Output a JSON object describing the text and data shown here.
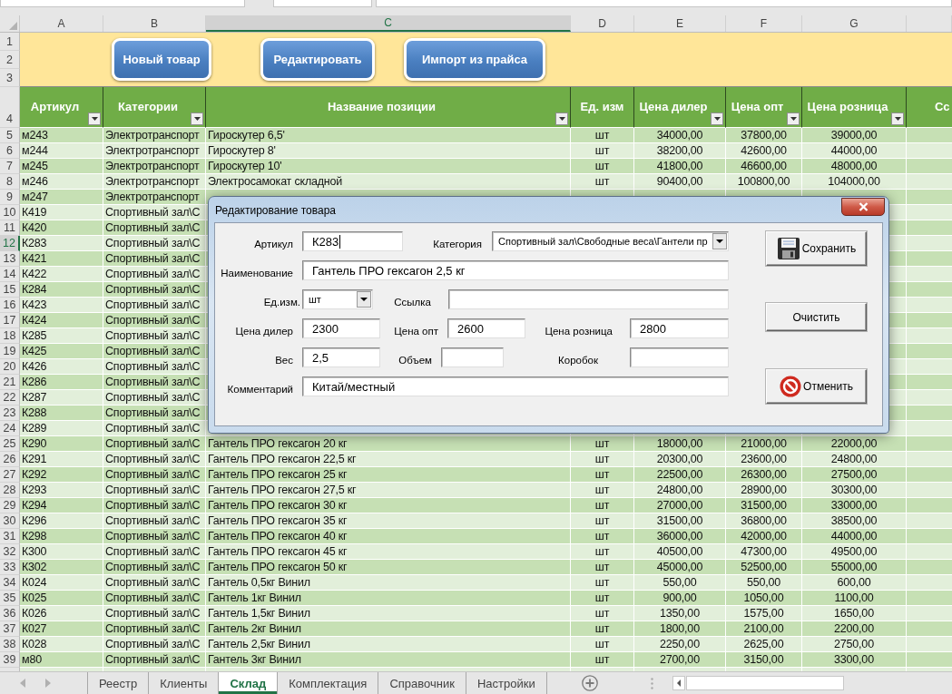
{
  "column_letters": [
    {
      "label": "A",
      "selected": false
    },
    {
      "label": "B",
      "selected": false
    },
    {
      "label": "C",
      "selected": true
    },
    {
      "label": "D",
      "selected": false
    },
    {
      "label": "E",
      "selected": false
    },
    {
      "label": "F",
      "selected": false
    },
    {
      "label": "G",
      "selected": false
    }
  ],
  "band_row_numbers": [
    "1",
    "2",
    "3"
  ],
  "toolbar_buttons": [
    "Новый товар",
    "Редактировать",
    "Импорт из прайса"
  ],
  "header": {
    "row_number": "4",
    "columns": [
      {
        "label": "Артикул",
        "filter": true
      },
      {
        "label": "Категории",
        "filter": true
      },
      {
        "label": "Название позиции",
        "filter": true
      },
      {
        "label": "Ед. изм",
        "filter": false
      },
      {
        "label": "Цена дилер",
        "filter": true
      },
      {
        "label": "Цена опт",
        "filter": true
      },
      {
        "label": "Цена розница",
        "filter": true
      },
      {
        "label": "Сс",
        "filter": false
      }
    ]
  },
  "rows": [
    {
      "number": "5",
      "selected": false,
      "cells": [
        "м243",
        "Электротранспорт",
        "Гироскутер 6,5'",
        "шт",
        "34000,00",
        "37800,00",
        "39000,00"
      ]
    },
    {
      "number": "6",
      "selected": false,
      "cells": [
        "м244",
        "Электротранспорт",
        "Гироскутер 8'",
        "шт",
        "38200,00",
        "42600,00",
        "44000,00"
      ]
    },
    {
      "number": "7",
      "selected": false,
      "cells": [
        "м245",
        "Электротранспорт",
        "Гироскутер 10'",
        "шт",
        "41800,00",
        "46600,00",
        "48000,00"
      ]
    },
    {
      "number": "8",
      "selected": false,
      "cells": [
        "м246",
        "Электротранспорт",
        "Электросамокат складной",
        "шт",
        "90400,00",
        "100800,00",
        "104000,00"
      ]
    },
    {
      "number": "9",
      "selected": false,
      "cells": [
        "м247",
        "Электротранспорт"
      ]
    },
    {
      "number": "10",
      "selected": false,
      "cells": [
        "К419",
        "Спортивный зал\\С"
      ]
    },
    {
      "number": "11",
      "selected": false,
      "cells": [
        "К420",
        "Спортивный зал\\С"
      ]
    },
    {
      "number": "12",
      "selected": true,
      "cells": [
        "К283",
        "Спортивный зал\\С"
      ]
    },
    {
      "number": "13",
      "selected": false,
      "cells": [
        "К421",
        "Спортивный зал\\С"
      ]
    },
    {
      "number": "14",
      "selected": false,
      "cells": [
        "К422",
        "Спортивный зал\\С"
      ]
    },
    {
      "number": "15",
      "selected": false,
      "cells": [
        "К284",
        "Спортивный зал\\С"
      ]
    },
    {
      "number": "16",
      "selected": false,
      "cells": [
        "К423",
        "Спортивный зал\\С"
      ]
    },
    {
      "number": "17",
      "selected": false,
      "cells": [
        "К424",
        "Спортивный зал\\С"
      ]
    },
    {
      "number": "18",
      "selected": false,
      "cells": [
        "К285",
        "Спортивный зал\\С"
      ]
    },
    {
      "number": "19",
      "selected": false,
      "cells": [
        "К425",
        "Спортивный зал\\С"
      ]
    },
    {
      "number": "20",
      "selected": false,
      "cells": [
        "К426",
        "Спортивный зал\\С"
      ]
    },
    {
      "number": "21",
      "selected": false,
      "cells": [
        "К286",
        "Спортивный зал\\С"
      ]
    },
    {
      "number": "22",
      "selected": false,
      "cells": [
        "К287",
        "Спортивный зал\\С"
      ]
    },
    {
      "number": "23",
      "selected": false,
      "cells": [
        "К288",
        "Спортивный зал\\С"
      ]
    },
    {
      "number": "24",
      "selected": false,
      "cells": [
        "К289",
        "Спортивный зал\\С"
      ]
    },
    {
      "number": "25",
      "selected": false,
      "cells": [
        "К290",
        "Спортивный зал\\С",
        "Гантель ПРО гексагон 20 кг",
        "шт",
        "18000,00",
        "21000,00",
        "22000,00"
      ]
    },
    {
      "number": "26",
      "selected": false,
      "cells": [
        "К291",
        "Спортивный зал\\С",
        "Гантель ПРО гексагон 22,5 кг",
        "шт",
        "20300,00",
        "23600,00",
        "24800,00"
      ]
    },
    {
      "number": "27",
      "selected": false,
      "cells": [
        "К292",
        "Спортивный зал\\С",
        "Гантель ПРО гексагон 25 кг",
        "шт",
        "22500,00",
        "26300,00",
        "27500,00"
      ]
    },
    {
      "number": "28",
      "selected": false,
      "cells": [
        "К293",
        "Спортивный зал\\С",
        "Гантель ПРО гексагон 27,5 кг",
        "шт",
        "24800,00",
        "28900,00",
        "30300,00"
      ]
    },
    {
      "number": "29",
      "selected": false,
      "cells": [
        "К294",
        "Спортивный зал\\С",
        "Гантель ПРО гексагон 30 кг",
        "шт",
        "27000,00",
        "31500,00",
        "33000,00"
      ]
    },
    {
      "number": "30",
      "selected": false,
      "cells": [
        "К296",
        "Спортивный зал\\С",
        "Гантель ПРО гексагон 35 кг",
        "шт",
        "31500,00",
        "36800,00",
        "38500,00"
      ]
    },
    {
      "number": "31",
      "selected": false,
      "cells": [
        "К298",
        "Спортивный зал\\С",
        "Гантель ПРО гексагон 40 кг",
        "шт",
        "36000,00",
        "42000,00",
        "44000,00"
      ]
    },
    {
      "number": "32",
      "selected": false,
      "cells": [
        "К300",
        "Спортивный зал\\С",
        "Гантель ПРО гексагон 45 кг",
        "шт",
        "40500,00",
        "47300,00",
        "49500,00"
      ]
    },
    {
      "number": "33",
      "selected": false,
      "cells": [
        "К302",
        "Спортивный зал\\С",
        "Гантель ПРО гексагон 50 кг",
        "шт",
        "45000,00",
        "52500,00",
        "55000,00"
      ]
    },
    {
      "number": "34",
      "selected": false,
      "cells": [
        "К024",
        "Спортивный зал\\С",
        "Гантель 0,5кг Винил",
        "шт",
        "550,00",
        "550,00",
        "600,00"
      ]
    },
    {
      "number": "35",
      "selected": false,
      "cells": [
        "К025",
        "Спортивный зал\\С",
        "Гантель 1кг Винил",
        "шт",
        "900,00",
        "1050,00",
        "1100,00"
      ]
    },
    {
      "number": "36",
      "selected": false,
      "cells": [
        "К026",
        "Спортивный зал\\С",
        "Гантель 1,5кг Винил",
        "шт",
        "1350,00",
        "1575,00",
        "1650,00"
      ]
    },
    {
      "number": "37",
      "selected": false,
      "cells": [
        "К027",
        "Спортивный зал\\С",
        "Гантель 2кг Винил",
        "шт",
        "1800,00",
        "2100,00",
        "2200,00"
      ]
    },
    {
      "number": "38",
      "selected": false,
      "cells": [
        "К028",
        "Спортивный зал\\С",
        "Гантель 2,5кг Винил",
        "шт",
        "2250,00",
        "2625,00",
        "2750,00"
      ]
    },
    {
      "number": "39",
      "selected": false,
      "cells": [
        "м80",
        "Спортивный зал\\С",
        "Гантель 3кг Винил",
        "шт",
        "2700,00",
        "3150,00",
        "3300,00"
      ]
    }
  ],
  "dialog": {
    "title": "Редактирование товара",
    "rows": [
      [
        {
          "label": "Артикул",
          "kind": "text",
          "value": "К283",
          "focused": true
        },
        {
          "label": "Категория",
          "kind": "combo",
          "value": "Спортивный зал\\Свободные веса\\Гантели пр",
          "focused": false
        }
      ],
      [
        {
          "label": "Наименование",
          "kind": "text",
          "value": "Гантель ПРО гексагон 2,5 кг",
          "focused": false
        }
      ],
      [
        {
          "label": "Ед.изм.",
          "kind": "combo",
          "value": "шт",
          "focused": false
        },
        {
          "label": "Ссылка",
          "kind": "text",
          "focused": false
        }
      ],
      [
        {
          "label": "Цена дилер",
          "kind": "text",
          "value": "2300",
          "focused": false
        },
        {
          "label": "Цена опт",
          "kind": "text",
          "value": "2600",
          "focused": false
        },
        {
          "label": "Цена розница",
          "kind": "text",
          "value": "2800",
          "focused": false
        }
      ],
      [
        {
          "label": "Вес",
          "kind": "text",
          "value": "2,5",
          "focused": false
        },
        {
          "label": "Объем",
          "kind": "text",
          "focused": false
        },
        {
          "label": "Коробок",
          "kind": "text",
          "focused": false
        }
      ],
      [
        {
          "label": "Комментарий",
          "kind": "text",
          "value": "Китай/местный",
          "focused": false
        }
      ]
    ],
    "buttons": [
      {
        "label": "Сохранить",
        "kind": "save"
      },
      {
        "label": "Очистить",
        "kind": "clear"
      },
      {
        "label": "Отменить",
        "kind": "cancel"
      }
    ]
  },
  "sheet_tabs": [
    {
      "label": "Реестр",
      "selected": false
    },
    {
      "label": "Клиенты",
      "selected": false
    },
    {
      "label": "Склад",
      "selected": true
    },
    {
      "label": "Комплектация",
      "selected": false
    },
    {
      "label": "Справочник",
      "selected": false
    },
    {
      "label": "Настройки",
      "selected": false
    }
  ]
}
